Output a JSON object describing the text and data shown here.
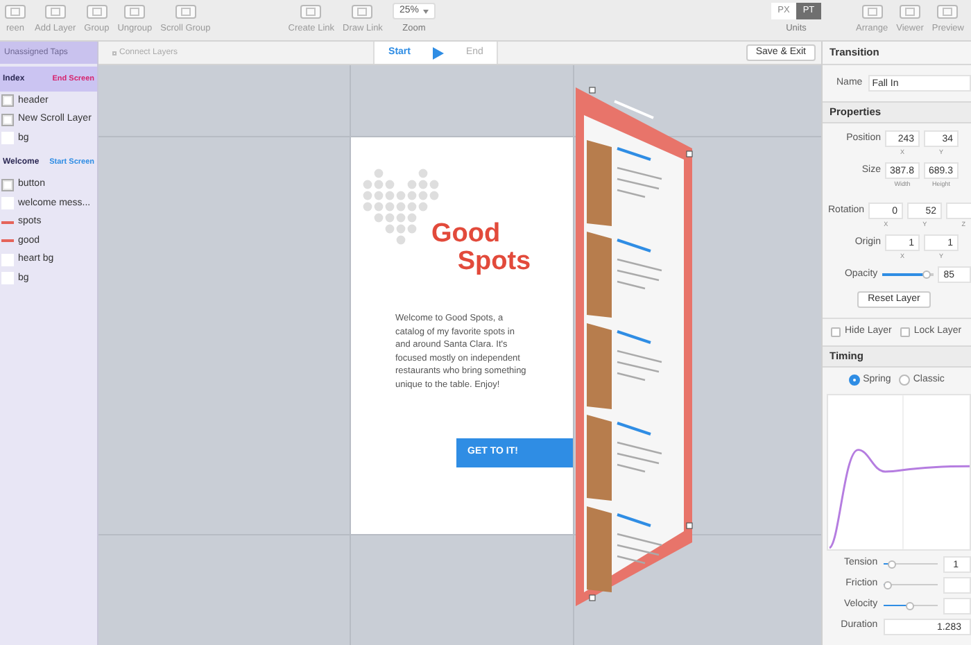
{
  "toolbar": {
    "left_tools": [
      {
        "label": "reen"
      },
      {
        "label": "Add Layer"
      },
      {
        "label": "Group"
      },
      {
        "label": "Ungroup"
      },
      {
        "label": "Scroll Group"
      }
    ],
    "link_tools": [
      {
        "label": "Create Link"
      },
      {
        "label": "Draw Link"
      }
    ],
    "zoom": {
      "value": "25%",
      "label": "Zoom"
    },
    "units": {
      "options": [
        {
          "label": "PX",
          "selected": false
        },
        {
          "label": "PT",
          "selected": true
        }
      ],
      "label": "Units"
    },
    "right_tools": [
      {
        "label": "Arrange"
      },
      {
        "label": "Viewer"
      },
      {
        "label": "Preview"
      }
    ]
  },
  "sidebar": {
    "header": "Unassigned Taps",
    "screens": [
      {
        "name": "Index",
        "tag": "End Screen",
        "color": "#d6246e",
        "layers": [
          {
            "name": "header",
            "kind": "box"
          },
          {
            "name": "New Scroll Layer",
            "kind": "box"
          },
          {
            "name": "bg",
            "kind": "plain"
          }
        ]
      },
      {
        "name": "Welcome",
        "tag": "Start Screen",
        "color": "#2f8de4",
        "layers": [
          {
            "name": "button",
            "kind": "box"
          },
          {
            "name": "welcome mess...",
            "kind": "plain"
          },
          {
            "name": "spots",
            "kind": "text"
          },
          {
            "name": "good",
            "kind": "text"
          },
          {
            "name": "heart bg",
            "kind": "plain"
          },
          {
            "name": "bg",
            "kind": "plain"
          }
        ]
      }
    ]
  },
  "canvas": {
    "connect_placeholder": "Connect Layers",
    "tabs": [
      {
        "label": "Start",
        "selected": true
      },
      {
        "label": "End",
        "selected": false
      }
    ],
    "save_button": "Save & Exit",
    "welcome_screen": {
      "title_1": "Good",
      "title_2": "Spots",
      "body": "Welcome to Good Spots, a catalog of my favorite spots in and around Santa Clara. It's focused mostly on independent restaurants who bring something unique to the table. Enjoy!",
      "button": "GET TO IT!"
    }
  },
  "inspector": {
    "transition": {
      "title": "Transition",
      "name_label": "Name",
      "name_value": "Fall In"
    },
    "properties": {
      "title": "Properties",
      "rows": [
        {
          "label": "Position",
          "fields": [
            {
              "value": "243",
              "caption": "X"
            },
            {
              "value": "34",
              "caption": "Y"
            }
          ]
        },
        {
          "label": "Size",
          "fields": [
            {
              "value": "387.8",
              "caption": "Width"
            },
            {
              "value": "689.3",
              "caption": "Height"
            }
          ]
        },
        {
          "label": "Rotation",
          "fields": [
            {
              "value": "0",
              "caption": "X"
            },
            {
              "value": "52",
              "caption": "Y"
            },
            {
              "caption": "Z"
            }
          ]
        },
        {
          "label": "Origin",
          "fields": [
            {
              "value": "1",
              "caption": "X"
            },
            {
              "value": "1",
              "caption": "Y"
            }
          ]
        }
      ],
      "opacity": {
        "label": "Opacity",
        "level": 0.85,
        "value": "85"
      },
      "reset_button": "Reset Layer",
      "checks": [
        {
          "label": "Hide Layer",
          "checked": false
        },
        {
          "label": "Lock Layer",
          "checked": false
        }
      ]
    },
    "timing": {
      "title": "Timing",
      "modes": [
        {
          "label": "Spring",
          "selected": true
        },
        {
          "label": "Classic",
          "selected": false
        }
      ],
      "sliders": [
        {
          "label": "Tension",
          "level": 0.15,
          "value": "1"
        },
        {
          "label": "Friction",
          "level": 0.08
        },
        {
          "label": "Velocity",
          "level": 0.5
        }
      ],
      "duration": {
        "label": "Duration",
        "value": "1.283"
      }
    }
  }
}
